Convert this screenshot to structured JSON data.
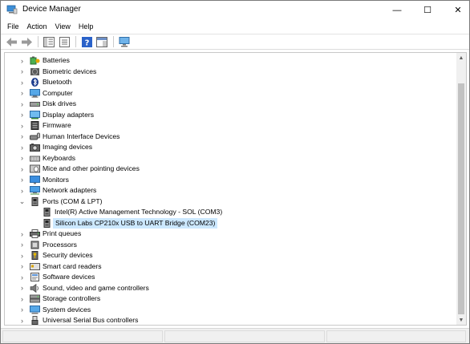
{
  "window": {
    "title": "Device Manager",
    "controls": {
      "minimize": "—",
      "maximize": "☐",
      "close": "✕"
    }
  },
  "menu": [
    "File",
    "Action",
    "View",
    "Help"
  ],
  "toolbar": {
    "buttons": [
      "back-icon",
      "forward-icon",
      "properties-icon",
      "show-hide-tree-icon",
      "help-icon",
      "action-pane-icon",
      "scan-hardware-icon"
    ]
  },
  "tree": {
    "items": [
      {
        "label": "Batteries",
        "icon": "battery-icon",
        "expanded": false
      },
      {
        "label": "Biometric devices",
        "icon": "fingerprint-icon",
        "expanded": false
      },
      {
        "label": "Bluetooth",
        "icon": "bluetooth-icon",
        "expanded": false
      },
      {
        "label": "Computer",
        "icon": "computer-icon",
        "expanded": false
      },
      {
        "label": "Disk drives",
        "icon": "disk-drive-icon",
        "expanded": false
      },
      {
        "label": "Display adapters",
        "icon": "display-adapter-icon",
        "expanded": false
      },
      {
        "label": "Firmware",
        "icon": "firmware-icon",
        "expanded": false
      },
      {
        "label": "Human Interface Devices",
        "icon": "hid-icon",
        "expanded": false
      },
      {
        "label": "Imaging devices",
        "icon": "camera-icon",
        "expanded": false
      },
      {
        "label": "Keyboards",
        "icon": "keyboard-icon",
        "expanded": false
      },
      {
        "label": "Mice and other pointing devices",
        "icon": "mouse-icon",
        "expanded": false
      },
      {
        "label": "Monitors",
        "icon": "monitor-icon",
        "expanded": false
      },
      {
        "label": "Network adapters",
        "icon": "network-adapter-icon",
        "expanded": false
      },
      {
        "label": "Ports (COM & LPT)",
        "icon": "port-icon",
        "expanded": true,
        "children": [
          {
            "label": "Intel(R) Active Management Technology - SOL (COM3)",
            "icon": "port-icon",
            "selected": false
          },
          {
            "label": "Silicon Labs CP210x USB to UART Bridge (COM23)",
            "icon": "port-icon",
            "selected": true
          }
        ]
      },
      {
        "label": "Print queues",
        "icon": "printer-icon",
        "expanded": false
      },
      {
        "label": "Processors",
        "icon": "processor-icon",
        "expanded": false
      },
      {
        "label": "Security devices",
        "icon": "security-key-icon",
        "expanded": false
      },
      {
        "label": "Smart card readers",
        "icon": "smart-card-icon",
        "expanded": false
      },
      {
        "label": "Software devices",
        "icon": "software-device-icon",
        "expanded": false
      },
      {
        "label": "Sound, video and game controllers",
        "icon": "speaker-icon",
        "expanded": false
      },
      {
        "label": "Storage controllers",
        "icon": "storage-controller-icon",
        "expanded": false
      },
      {
        "label": "System devices",
        "icon": "system-device-icon",
        "expanded": false
      },
      {
        "label": "Universal Serial Bus controllers",
        "icon": "usb-icon",
        "expanded": false
      }
    ]
  },
  "colors": {
    "selection": "#cce8ff",
    "accent": "#1e78d7"
  }
}
